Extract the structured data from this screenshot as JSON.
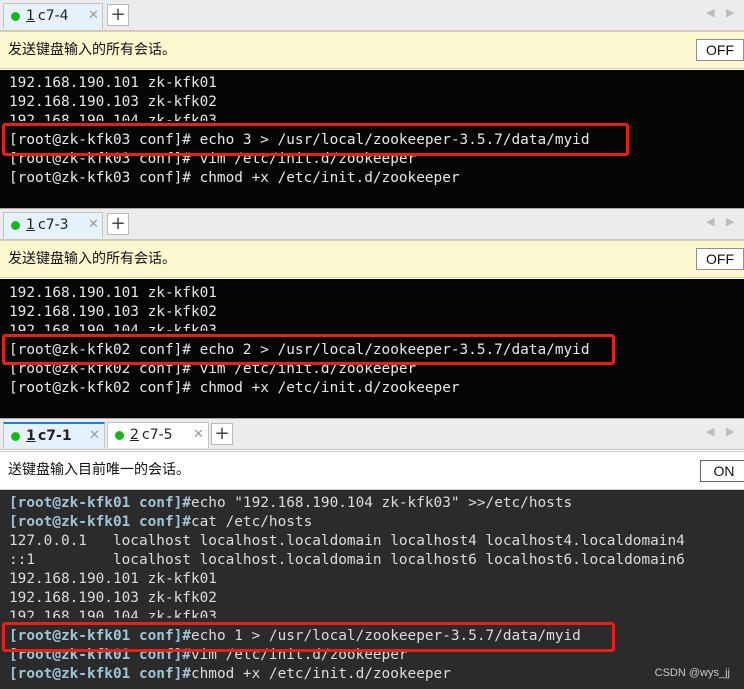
{
  "pane1": {
    "tab": {
      "number": "1",
      "name": "c7-4",
      "close": "✕"
    },
    "add": "+",
    "nav_prev": "◀",
    "nav_next": "▶",
    "notice": "发送键盘输入的所有会话。",
    "toggle": "OFF",
    "lines": [
      "192.168.190.101 zk-kfk01",
      "192.168.190.103 zk-kfk02",
      "192.168.190.104 zk-kfk03",
      "[root@zk-kfk03 conf]# echo 3 > /usr/local/zookeeper-3.5.7/data/myid",
      "[root@zk-kfk03 conf]# vim /etc/init.d/zookeeper",
      "[root@zk-kfk03 conf]# chmod +x /etc/init.d/zookeeper"
    ]
  },
  "pane2": {
    "tab": {
      "number": "1",
      "name": "c7-3",
      "close": "✕"
    },
    "add": "+",
    "nav_prev": "◀",
    "nav_next": "▶",
    "notice": "发送键盘输入的所有会话。",
    "toggle": "OFF",
    "lines": [
      "192.168.190.101 zk-kfk01",
      "192.168.190.103 zk-kfk02",
      "192.168.190.104 zk-kfk03",
      "[root@zk-kfk02 conf]# echo 2 > /usr/local/zookeeper-3.5.7/data/myid",
      "[root@zk-kfk02 conf]# vim /etc/init.d/zookeeper",
      "[root@zk-kfk02 conf]# chmod +x /etc/init.d/zookeeper"
    ]
  },
  "pane3": {
    "tabs": [
      {
        "number": "1",
        "name": "c7-1",
        "close": "✕"
      },
      {
        "number": "2",
        "name": "c7-5",
        "close": "✕"
      }
    ],
    "add": "+",
    "nav_prev": "◀",
    "nav_next": "▶",
    "notice": "送键盘输入目前唯一的会话。",
    "toggle": "ON",
    "prompt": "[root@zk-kfk01 conf]#",
    "lines": [
      {
        "prompt": "[root@zk-kfk01 conf]#",
        "text": "echo \"192.168.190.104 zk-kfk03\" >>/etc/hosts"
      },
      {
        "prompt": "[root@zk-kfk01 conf]#",
        "text": "cat /etc/hosts"
      },
      {
        "prompt": "",
        "text": "127.0.0.1   localhost localhost.localdomain localhost4 localhost4.localdomain4"
      },
      {
        "prompt": "",
        "text": "::1         localhost localhost.localdomain localhost6 localhost6.localdomain6"
      },
      {
        "prompt": "",
        "text": "192.168.190.101 zk-kfk01"
      },
      {
        "prompt": "",
        "text": "192.168.190.103 zk-kfk02"
      },
      {
        "prompt": "",
        "text": "192.168.190.104 zk-kfk03"
      },
      {
        "prompt": "[root@zk-kfk01 conf]#",
        "text": "echo 1 > /usr/local/zookeeper-3.5.7/data/myid"
      },
      {
        "prompt": "[root@zk-kfk01 conf]#",
        "text": "vim /etc/init.d/zookeeper"
      },
      {
        "prompt": "[root@zk-kfk01 conf]#",
        "text": "chmod +x /etc/init.d/zookeeper"
      }
    ]
  },
  "watermark": "CSDN @wys_jj",
  "colors": {
    "highlight": "#e8201a",
    "prompt": "#9fc6d6",
    "active_tab_accent": "#1a7fd4",
    "notice_bg": "#fbf7cf",
    "status_dot": "#19b819"
  }
}
